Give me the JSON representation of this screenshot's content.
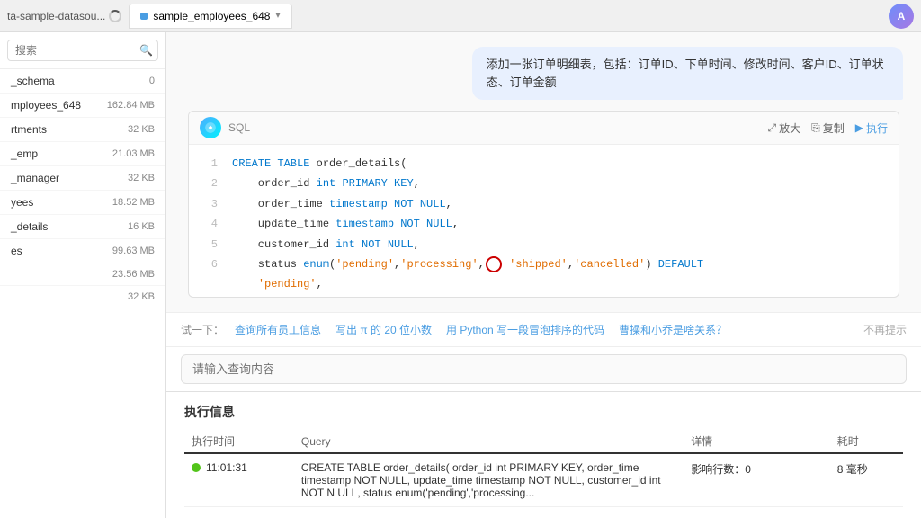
{
  "topbar": {
    "left_label": "ta-sample-datasou...",
    "tab_name": "sample_employees_648",
    "avatar_initials": "A"
  },
  "sidebar": {
    "search_placeholder": "搜索",
    "items": [
      {
        "name": "_schema",
        "size": "0"
      },
      {
        "name": "mployees_648",
        "size": "162.84 MB"
      },
      {
        "name": "rtments",
        "size": "32 KB"
      },
      {
        "name": "_emp",
        "size": "21.03 MB"
      },
      {
        "name": "_manager",
        "size": "32 KB"
      },
      {
        "name": "yees",
        "size": "18.52 MB"
      },
      {
        "name": "_details",
        "size": "16 KB"
      },
      {
        "name": "es",
        "size": "99.63 MB"
      },
      {
        "name": "",
        "size": "23.56 MB"
      },
      {
        "name": "",
        "size": "32 KB"
      }
    ]
  },
  "chat": {
    "user_message": "添加一张订单明细表，包括：订单ID、下单时间、修改时间、客户ID、订单状态、订单金额"
  },
  "sql_block": {
    "label": "SQL",
    "action_zoom": "放大",
    "action_copy": "复制",
    "action_run": "执行",
    "lines": [
      {
        "num": "1",
        "content": "CREATE TABLE order_details("
      },
      {
        "num": "2",
        "content": "    order_id int PRIMARY KEY,"
      },
      {
        "num": "3",
        "content": "    order_time timestamp NOT NULL,"
      },
      {
        "num": "4",
        "content": "    update_time timestamp NOT NULL,"
      },
      {
        "num": "5",
        "content": "    customer_id int NOT NULL,"
      },
      {
        "num": "6",
        "content": "    status enum('pending','processing', 'shipped','cancelled') DEFAULT"
      },
      {
        "num": "",
        "content": "    'pending',"
      }
    ]
  },
  "suggestions": {
    "label": "试一下：",
    "items": [
      "查询所有员工信息",
      "写出 π 的 20 位小数",
      "用 Python 写一段冒泡排序的代码",
      "曹操和小乔是啥关系？"
    ],
    "dismiss": "不再提示"
  },
  "query_input": {
    "placeholder": "请输入查询内容"
  },
  "exec_info": {
    "title": "执行信息",
    "columns": [
      "执行时间",
      "Query",
      "详情",
      "耗时"
    ],
    "rows": [
      {
        "status": "success",
        "time": "11:01:31",
        "query": "CREATE TABLE order_details( order_id int PRIMARY KEY, order_time timestamp NOT NULL, update_time timestamp NOT NULL, customer_id int NOT N ULL, status enum('pending','processing...",
        "detail": "影响行数：0",
        "duration": "8 毫秒"
      }
    ]
  }
}
